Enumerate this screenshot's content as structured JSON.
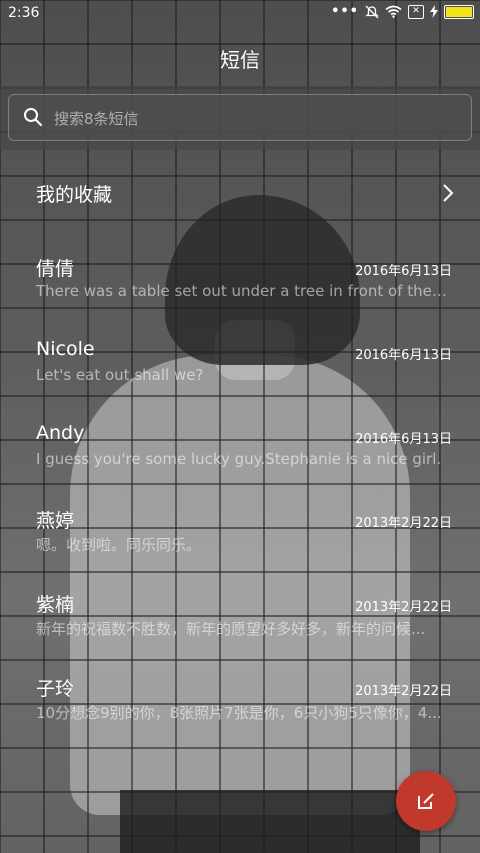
{
  "status_bar": {
    "time": "2:36",
    "icons": [
      "more-dots-icon",
      "mute-icon",
      "wifi-icon",
      "no-sim-icon",
      "charging-icon",
      "battery-icon"
    ],
    "battery_color": "#f3e31a"
  },
  "header": {
    "title": "短信"
  },
  "search": {
    "placeholder": "搜索8条短信"
  },
  "favorites": {
    "label": "我的收藏"
  },
  "messages": [
    {
      "name": "倩倩",
      "date": "2016年6月13日",
      "preview": "There was a table set out under a tree in front of the ho..."
    },
    {
      "name": "Nicole",
      "date": "2016年6月13日",
      "preview": "Let's eat out,shall we?"
    },
    {
      "name": "Andy",
      "date": "2016年6月13日",
      "preview": "I guess you're some lucky guy.Stephanie is a nice girl."
    },
    {
      "name": "燕婷",
      "date": "2013年2月22日",
      "preview": "嗯。收到啦。同乐同乐。"
    },
    {
      "name": "紫楠",
      "date": "2013年2月22日",
      "preview": "新年的祝福数不胜数，新年的愿望好多好多，新年的问候..."
    },
    {
      "name": "子玲",
      "date": "2013年2月22日",
      "preview": "10分想念9别的你，8张照片7张是你，6只小狗5只像你，4..."
    }
  ],
  "fab": {
    "icon": "compose-icon",
    "color": "#c0392b"
  }
}
